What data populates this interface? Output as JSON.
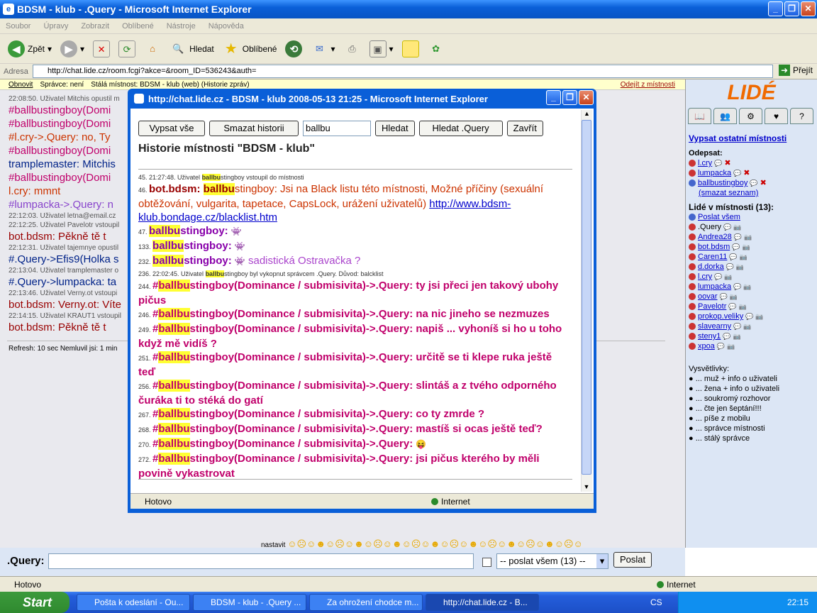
{
  "window": {
    "title": "BDSM - klub - .Query - Microsoft Internet Explorer"
  },
  "menu": [
    "Soubor",
    "Úpravy",
    "Zobrazit",
    "Oblíbené",
    "Nástroje",
    "Nápověda"
  ],
  "toolbar": {
    "back": "Zpět",
    "search": "Hledat",
    "favorites": "Oblíbené"
  },
  "address": {
    "label": "Adresa",
    "url": "http://chat.lide.cz/room.fcgi?akce=&room_ID=536243&auth=",
    "go": "Přejít"
  },
  "strip": {
    "refresh": "Obnovit",
    "admin": "Správce: není",
    "room": "Stálá místnost: BDSM - klub (web)  (Historie zpráv)",
    "leave": "Odejít z místnosti"
  },
  "chat": [
    {
      "sm": "22:08:50. Uživatel Mitchis opustil m"
    },
    {
      "t": "#ballbustingboy(Domi",
      "c": "#c0006b"
    },
    {
      "t": "#ballbustingboy(Domi",
      "c": "#c0006b"
    },
    {
      "t": "#l.cry->.Query: no, Ty",
      "c": "#cc3300"
    },
    {
      "t": "#ballbustingboy(Domi",
      "c": "#c0006b"
    },
    {
      "t": "tramplemaster: Mitchis",
      "c": "#002288"
    },
    {
      "t": "#ballbustingboy(Domi",
      "c": "#c0006b"
    },
    {
      "t": "l.cry: mmnt",
      "c": "#cc3300"
    },
    {
      "t": "#lumpacka->.Query: n",
      "c": "#8844cc"
    },
    {
      "sm": "22:12:03. Uživatel letna@email.cz"
    },
    {
      "sm": "22:12:25. Uživatel Pavelotr vstoupil"
    },
    {
      "t": "bot.bdsm: Pěkně tě t",
      "c": "#990000"
    },
    {
      "sm": "22:12:31. Uživatel tajemnye opustil"
    },
    {
      "t": "#.Query->Efis9(Holka s",
      "c": "#002288"
    },
    {
      "sm": "22:13:04. Uživatel tramplemaster o"
    },
    {
      "t": "#.Query->lumpacka: ta",
      "c": "#002288"
    },
    {
      "sm": "22:13:46. Uživatel Verny.ot vstoupi"
    },
    {
      "t": "bot.bdsm: Verny.ot: Víte",
      "c": "#990000"
    },
    {
      "sm": "22:14:15. Uživatel KRAUT1 vstoupil"
    },
    {
      "t": "bot.bdsm: Pěkně tě t",
      "c": "#990000"
    }
  ],
  "refresh_text": "Refresh: 10 sec    Nemluvil jsi: 1 min",
  "right": {
    "logo": "LIDÉ",
    "list_other": "Vypsat ostatní místnosti",
    "unsub": "Odepsat:",
    "unsub_users": [
      "l.cry",
      "lumpacka",
      "ballbustingboy"
    ],
    "clear": "(smazat seznam)",
    "people_title": "Lidé v místnosti (13):",
    "send_all": "Poslat všem",
    "users": [
      ".Query",
      "Andrea28",
      "bot.bdsm",
      "Caren11",
      "d.dorka",
      "l.cry",
      "lumpacka",
      "oovar",
      "Pavelotr",
      "prokop.veliky",
      "slavearny",
      "steny1",
      "xpoa"
    ],
    "legend_title": "Vysvětlivky:",
    "legend": [
      "... muž + info o uživateli",
      "... žena + info o uživateli",
      "... soukromý rozhovor",
      "... čte jen šeptání!!!",
      "... píše z mobilu",
      "... správce místnosti",
      "... stálý správce"
    ]
  },
  "bottom": {
    "nick": ".Query:",
    "send_opt": "-- poslat všem (13) --",
    "send": "Poslat",
    "smileys": "nastavit"
  },
  "popup": {
    "title": "http://chat.lide.cz - BDSM - klub 2008-05-13 21:25 - Microsoft Internet Explorer",
    "btn_all": "Vypsat vše",
    "btn_clear": "Smazat historii",
    "search_val": "ballbu",
    "btn_search": "Hledat",
    "btn_search_q": "Hledat .Query",
    "btn_close": "Zavřít",
    "heading": "Historie místnosti \"BDSM - klub\"",
    "status": "Hotovo",
    "zone": "Internet",
    "lines": [
      {
        "n": "45. 21:27:48. Uživatel ",
        "hl": "ballbu",
        "rest": "stingboy vstoupil do místnosti",
        "small": true
      },
      {
        "n": "46.",
        "pre": "bot.bdsm: ",
        "hl": "ballbu",
        "rest": "stingboy: Jsi na Black listu této místnosti, Možné příčiny (sexuální obtěžování, vulgarita, tapetace, CapsLock, urážení uživatelů) ",
        "link": "http://www.bdsm-klub.bondage.cz/blacklist.htm",
        "style": "bot"
      },
      {
        "n": "47.",
        "hl": "ballbu",
        "rest": "stingboy: ",
        "style": "user"
      },
      {
        "n": "133.",
        "hl": "ballbu",
        "rest": "stingboy: ",
        "style": "user"
      },
      {
        "n": "232.",
        "hl": "ballbu",
        "rest": "stingboy: ",
        "msg": "sadistická Ostravačka ?",
        "style": "user"
      },
      {
        "n": "236. 22:02:45. Uživatel ",
        "hl": "ballbu",
        "rest": "stingboy byl vykopnut správcem .Query. Důvod: balcklist",
        "small": true
      },
      {
        "n": "244.",
        "hl": "ballbu",
        "msg": "ty jsi přeci jen takový ubohy pičus",
        "style": "pk"
      },
      {
        "n": "246.",
        "hl": "ballbu",
        "msg": "na nic jineho se nezmuzes",
        "style": "pk"
      },
      {
        "n": "249.",
        "hl": "ballbu",
        "msg": "napiš ... vyhoníš si ho u toho když mě vidíš ?",
        "style": "pk"
      },
      {
        "n": "251.",
        "hl": "ballbu",
        "msg": "určitě se ti klepe ruka ještě teď",
        "style": "pk"
      },
      {
        "n": "256.",
        "hl": "ballbu",
        "msg": "slintáš a z tvého odporného čuráka ti to stéká do gatí",
        "style": "pk"
      },
      {
        "n": "267.",
        "hl": "ballbu",
        "msg": "co ty zmrde ?",
        "style": "pk"
      },
      {
        "n": "268.",
        "hl": "ballbu",
        "msg": "mastíš si ocas ještě teď?",
        "style": "pk"
      },
      {
        "n": "270.",
        "hl": "ballbu",
        "msg": "",
        "style": "pk"
      },
      {
        "n": "272.",
        "hl": "ballbu",
        "msg": "jsi pičus kterého by měli povině vykastrovat",
        "style": "pk"
      }
    ]
  },
  "statusbar": {
    "left": "Hotovo",
    "right": "Internet"
  },
  "taskbar": {
    "start": "Start",
    "tasks": [
      "Pošta k odeslání - Ou...",
      "BDSM - klub - .Query ...",
      "Za ohrožení chodce m...",
      "http://chat.lide.cz - B..."
    ],
    "lang": "CS",
    "clock": "22:15"
  }
}
